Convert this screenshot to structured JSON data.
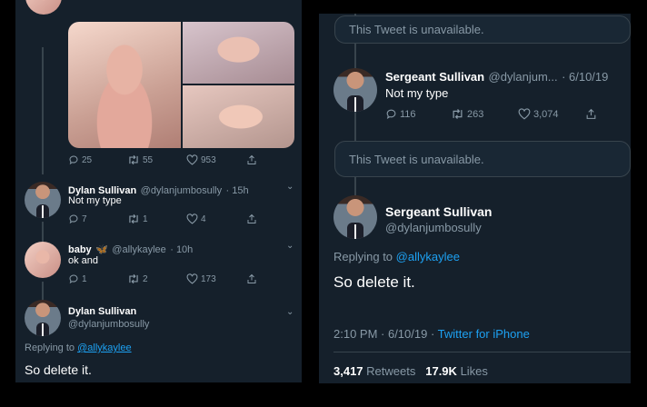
{
  "left": {
    "tweet_media": {
      "replies": "25",
      "retweets": "55",
      "likes": "953"
    },
    "reply1": {
      "name": "Dylan Sullivan",
      "handle": "@dylanjumbosully",
      "time": "· 15h",
      "text": "Not my type",
      "replies": "7",
      "retweets": "1",
      "likes": "4"
    },
    "reply2": {
      "name": "baby",
      "emoji": "🦋",
      "handle": "@allykaylee",
      "time": "· 10h",
      "text": "ok and",
      "replies": "1",
      "retweets": "2",
      "likes": "173"
    },
    "reply3": {
      "name": "Dylan Sullivan",
      "handle": "@dylanjumbosully",
      "replying_prefix": "Replying to",
      "replying_to": "@allykaylee",
      "text": "So delete it."
    }
  },
  "right": {
    "unavailable1": "This Tweet is unavailable.",
    "tweet1": {
      "name": "Sergeant Sullivan",
      "handle": "@dylanjum...",
      "date": "· 6/10/19",
      "text": "Not my type",
      "replies": "116",
      "retweets": "263",
      "likes": "3,074"
    },
    "unavailable2": "This Tweet is unavailable.",
    "main": {
      "name": "Sergeant Sullivan",
      "handle": "@dylanjumbosully",
      "replying_prefix": "Replying to",
      "replying_to": "@allykaylee",
      "text": "So delete it.",
      "time": "2:10 PM · 6/10/19 ·",
      "source": "Twitter for iPhone",
      "retweets_count": "3,417",
      "retweets_label": "Retweets",
      "likes_count": "17.9K",
      "likes_label": "Likes"
    }
  },
  "colors": {
    "background": "#15202b",
    "accent": "#1da1f2",
    "muted": "#8899a6",
    "border": "#38444d"
  },
  "icons": [
    "reply-icon",
    "retweet-icon",
    "like-icon",
    "share-icon",
    "chevron-down-icon",
    "butterfly-emoji"
  ]
}
